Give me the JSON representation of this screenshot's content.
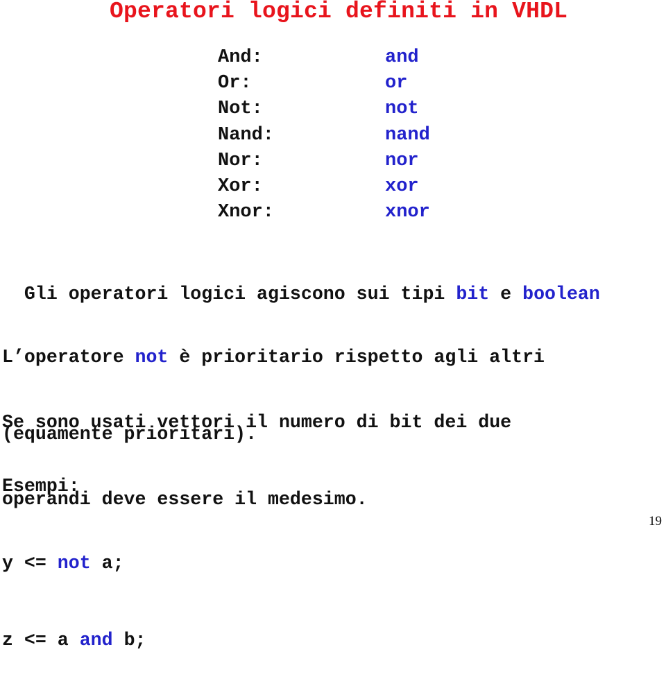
{
  "slide": {
    "title": "Operatori logici definiti in VHDL",
    "operators": [
      {
        "name": "And:",
        "keyword": "and"
      },
      {
        "name": "Or:",
        "keyword": "or"
      },
      {
        "name": "Not:",
        "keyword": "not"
      },
      {
        "name": "Nand:",
        "keyword": "nand"
      },
      {
        "name": "Nor:",
        "keyword": "nor"
      },
      {
        "name": "Xor:",
        "keyword": "xor"
      },
      {
        "name": "Xnor:",
        "keyword": "xnor"
      }
    ],
    "types_line": {
      "prefix": "Gli operatori logici agiscono sui tipi ",
      "type1": "bit",
      "middle": " e ",
      "type2": "boolean"
    },
    "priority": {
      "prefix": "L’operatore ",
      "keyword": "not",
      "suffix": " è prioritario rispetto agli altri",
      "line2": "(equamente prioritari)."
    },
    "vectors": {
      "line1": "Se sono usati vettori il numero di bit dei due",
      "line2": "operandi deve essere il medesimo."
    },
    "examples": {
      "heading": "Esempi:",
      "ex1": {
        "lhs": "y <= ",
        "kw": "not",
        "rhs": " a;"
      },
      "ex2": {
        "lhs": "z <= a ",
        "kw": "and",
        "rhs": " b;"
      }
    },
    "page_number": "19",
    "colors": {
      "title": "#e8141c",
      "keyword": "#2222cc",
      "text": "#111111"
    }
  }
}
